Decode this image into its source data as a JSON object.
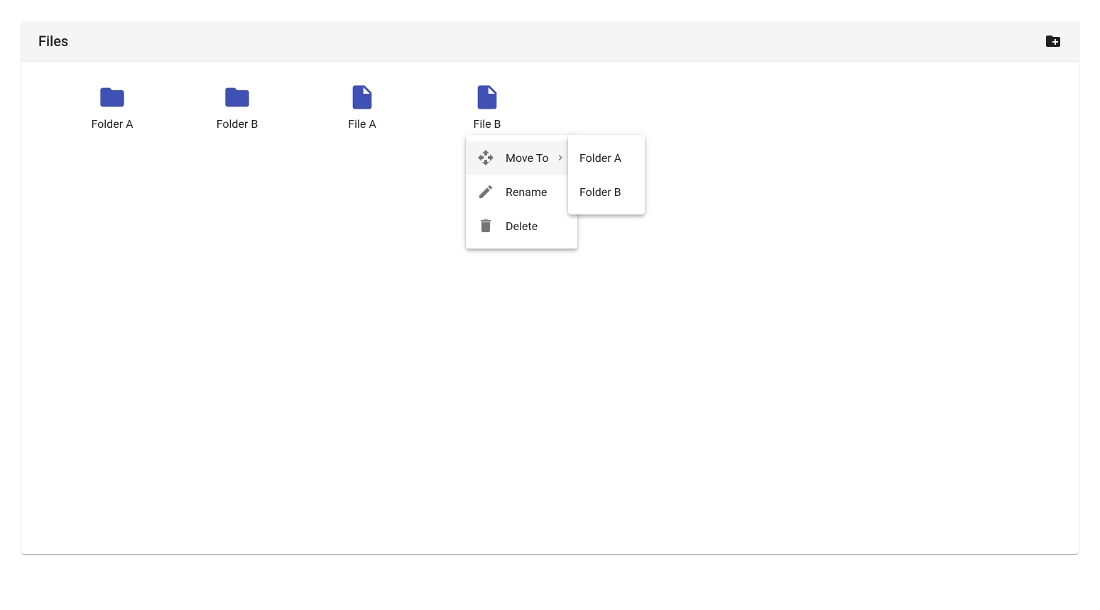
{
  "header": {
    "title": "Files"
  },
  "items": [
    {
      "type": "folder",
      "label": "Folder A"
    },
    {
      "type": "folder",
      "label": "Folder B"
    },
    {
      "type": "file",
      "label": "File A"
    },
    {
      "type": "file",
      "label": "File B"
    }
  ],
  "contextMenu": {
    "moveTo": "Move To",
    "rename": "Rename",
    "delete": "Delete"
  },
  "moveTargets": [
    "Folder A",
    "Folder B"
  ]
}
